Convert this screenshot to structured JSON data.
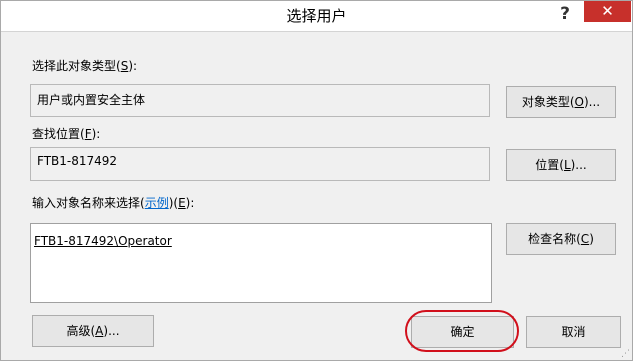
{
  "dialog": {
    "title": "选择用户",
    "help": "?",
    "close": "✕"
  },
  "object_type": {
    "label_prefix": "选择此对象类型(",
    "accel": "S",
    "label_suffix": "):",
    "value": "用户或内置安全主体",
    "button_prefix": "对象类型(",
    "button_accel": "O",
    "button_suffix": ")..."
  },
  "location": {
    "label_prefix": "查找位置(",
    "accel": "F",
    "label_suffix": "):",
    "value": "FTB1-817492",
    "button_prefix": "位置(",
    "button_accel": "L",
    "button_suffix": ")..."
  },
  "object_names": {
    "label_prefix": "输入对象名称来选择(",
    "example_link": "示例",
    "label_mid": ")(",
    "accel": "E",
    "label_suffix": "):",
    "value": "FTB1-817492\\Operator",
    "check_prefix": "检查名称(",
    "check_accel": "C",
    "check_suffix": ")"
  },
  "footer": {
    "advanced_prefix": "高级(",
    "advanced_accel": "A",
    "advanced_suffix": ")...",
    "ok": "确定",
    "cancel": "取消"
  }
}
